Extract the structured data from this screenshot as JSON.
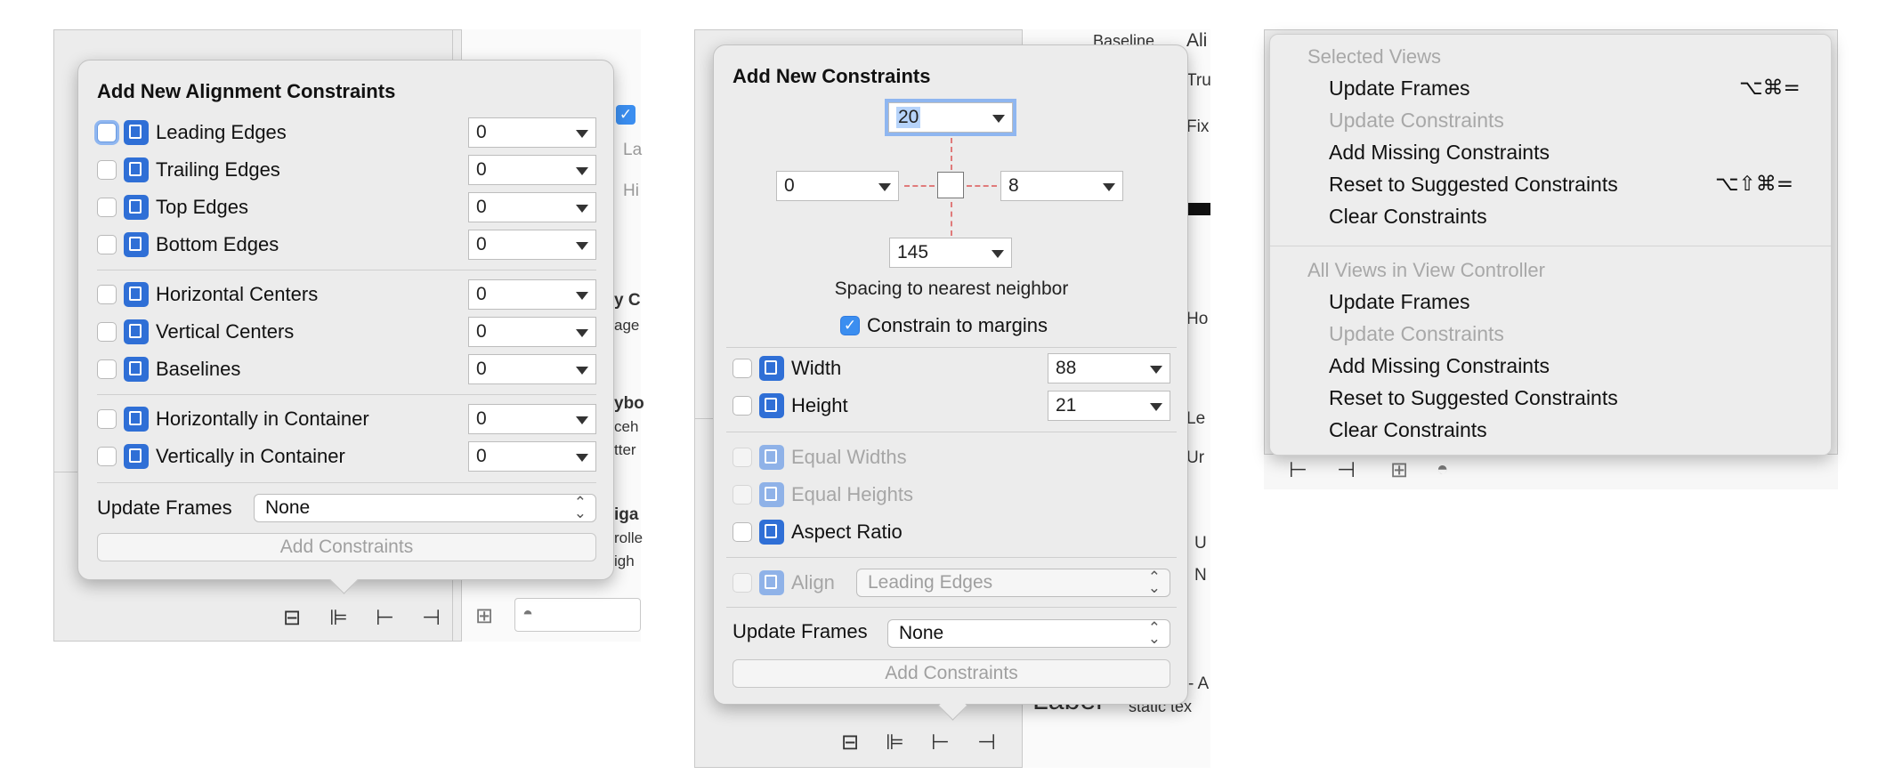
{
  "panel1": {
    "title": "Add New Alignment Constraints",
    "rows": [
      {
        "label": "Leading Edges",
        "value": "0"
      },
      {
        "label": "Trailing Edges",
        "value": "0"
      },
      {
        "label": "Top Edges",
        "value": "0"
      },
      {
        "label": "Bottom Edges",
        "value": "0"
      },
      {
        "label": "Horizontal Centers",
        "value": "0"
      },
      {
        "label": "Vertical Centers",
        "value": "0"
      },
      {
        "label": "Baselines",
        "value": "0"
      },
      {
        "label": "Horizontally in Container",
        "value": "0"
      },
      {
        "label": "Vertically in Container",
        "value": "0"
      }
    ],
    "update_frames_label": "Update Frames",
    "update_frames_value": "None",
    "add_button": "Add Constraints",
    "bg_fragments": [
      "y C",
      "age",
      "ybo",
      "ceh",
      "tter",
      "iga",
      "rolle",
      "igh",
      "La",
      "Hi"
    ]
  },
  "panel2": {
    "title": "Add New Constraints",
    "top_value": "20",
    "left_value": "0",
    "right_value": "8",
    "bottom_value": "145",
    "spacing_label": "Spacing to nearest neighbor",
    "margins_label": "Constrain to margins",
    "width_label": "Width",
    "width_value": "88",
    "height_label": "Height",
    "height_value": "21",
    "equal_widths": "Equal Widths",
    "equal_heights": "Equal Heights",
    "aspect_ratio": "Aspect Ratio",
    "align_label": "Align",
    "align_value": "Leading Edges",
    "update_frames_label": "Update Frames",
    "update_frames_value": "None",
    "add_button": "Add Constraints",
    "bg_fragments": [
      "Baseline",
      "Ali",
      "Tru",
      "Fix",
      "Ho",
      "Le",
      "Ur",
      "U",
      "N",
      "- A",
      "Label",
      "static tex"
    ]
  },
  "menu": {
    "section1_header": "Selected Views",
    "section1_items": [
      {
        "label": "Update Frames",
        "shortcut": "⌥⌘=",
        "disabled": false
      },
      {
        "label": "Update Constraints",
        "shortcut": "",
        "disabled": true
      },
      {
        "label": "Add Missing Constraints",
        "shortcut": "",
        "disabled": false
      },
      {
        "label": "Reset to Suggested Constraints",
        "shortcut": "⌥⇧⌘=",
        "disabled": false
      },
      {
        "label": "Clear Constraints",
        "shortcut": "",
        "disabled": false
      }
    ],
    "section2_header": "All Views in View Controller",
    "section2_items": [
      {
        "label": "Update Frames",
        "disabled": false
      },
      {
        "label": "Update Constraints",
        "disabled": true
      },
      {
        "label": "Add Missing Constraints",
        "disabled": false
      },
      {
        "label": "Reset to Suggested Constraints",
        "disabled": false
      },
      {
        "label": "Clear Constraints",
        "disabled": false
      }
    ]
  },
  "colors": {
    "accent": "#2f6fd6",
    "popover_bg": "#ececec",
    "strut": "#e07b7b"
  }
}
